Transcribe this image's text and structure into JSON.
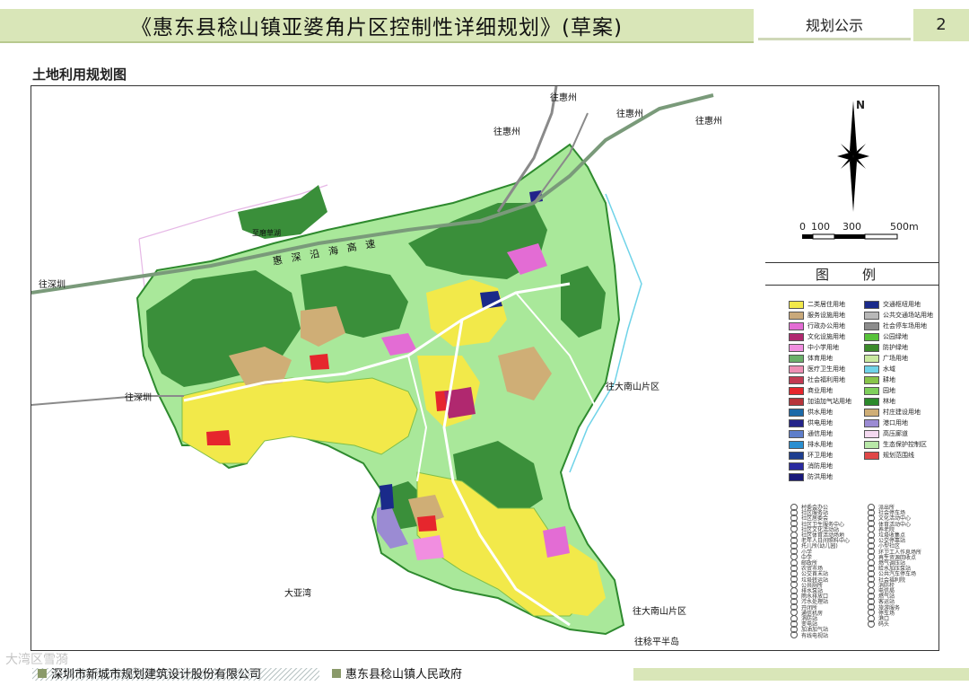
{
  "header": {
    "title": "《惠东县稔山镇亚婆角片区控制性详细规划》(草案)",
    "subtitle": "规划公示",
    "page_number": "2"
  },
  "section_title": "土地利用规划图",
  "map_labels": {
    "to_huizhou_1": "往惠州",
    "to_huizhou_2": "往惠州",
    "to_huizhou_3": "往惠州",
    "to_huizhou_4": "往惠州",
    "to_shenzhen_1": "往深圳",
    "to_shenzhen_2": "往深圳",
    "to_danan_1": "往大南山片区",
    "to_danan_2": "往大南山片区",
    "to_jianping": "往稔平半岛",
    "dayawan": "大亚湾",
    "zhimotouwan": "至磨草湖",
    "coastal_highway": "惠深沿海高速"
  },
  "compass": {
    "north": "N",
    "scale_ticks": [
      "0",
      "100",
      "300",
      "500m"
    ]
  },
  "legend": {
    "title_chars": [
      "图",
      "例"
    ],
    "left_items": [
      {
        "label": "二类居住用地",
        "color": "#f2e94a"
      },
      {
        "label": "服务设施用地",
        "color": "#c9a97a"
      },
      {
        "label": "行政办公用地",
        "color": "#e36cd4"
      },
      {
        "label": "文化设施用地",
        "color": "#b0286f"
      },
      {
        "label": "中小学用地",
        "color": "#f18ee0"
      },
      {
        "label": "体育用地",
        "color": "#6bb06a"
      },
      {
        "label": "医疗卫生用地",
        "color": "#ee8fb5"
      },
      {
        "label": "社会福利用地",
        "color": "#c33a53"
      },
      {
        "label": "商业用地",
        "color": "#e6262d"
      },
      {
        "label": "加油加气站用地",
        "color": "#b7343a"
      },
      {
        "label": "供水用地",
        "color": "#1c6aa8"
      },
      {
        "label": "供电用地",
        "color": "#23238a"
      },
      {
        "label": "通信用地",
        "color": "#5e7ecb"
      },
      {
        "label": "排水用地",
        "color": "#2a8fd0"
      },
      {
        "label": "环卫用地",
        "color": "#1e3e8f"
      },
      {
        "label": "消防用地",
        "color": "#2b2ba0"
      },
      {
        "label": "防洪用地",
        "color": "#18187a"
      }
    ],
    "right_items": [
      {
        "label": "交通枢纽用地",
        "color": "#1a2a8a"
      },
      {
        "label": "公共交通场站用地",
        "color": "#b8b8b8"
      },
      {
        "label": "社会停车场用地",
        "color": "#8c8c8c"
      },
      {
        "label": "公园绿地",
        "color": "#57c23a"
      },
      {
        "label": "防护绿地",
        "color": "#3b8a2a"
      },
      {
        "label": "广场用地",
        "color": "#c9e9a0"
      },
      {
        "label": "水域",
        "color": "#6fd3e8"
      },
      {
        "label": "耕地",
        "color": "#88c44a"
      },
      {
        "label": "园地",
        "color": "#7fcf5c"
      },
      {
        "label": "林地",
        "color": "#2c8a2c"
      },
      {
        "label": "村庄建设用地",
        "color": "#cfae76"
      },
      {
        "label": "港口用地",
        "color": "#9b8bd3"
      },
      {
        "label": "高压廊道",
        "color": "#f4d9f0"
      },
      {
        "label": "生态保护控制区",
        "color": "#b8e8a8"
      },
      {
        "label": "规划范围线",
        "color": "#e04848"
      }
    ],
    "icons_left": [
      "村委会办公",
      "社区服务站",
      "社区居委会",
      "社区卫生服务中心",
      "社区文化活动站",
      "社区体育活动场地",
      "老年人日间照料中心",
      "托儿所(幼儿园)",
      "小学",
      "中学",
      "邮政所",
      "农贸市场",
      "公交首末站",
      "垃圾转运站",
      "公共厕所",
      "排水泵站",
      "雨水排放口",
      "污水处理站",
      "开闭所",
      "通信机房",
      "消防站",
      "变电站",
      "加油加气站",
      "有线电视站"
    ],
    "icons_right": [
      "派出所",
      "社会停车场",
      "文化活动中心",
      "体育活动中心",
      "养老院",
      "垃圾收集点",
      "公交停靠站",
      "小型社区",
      "环卫工人作息场所",
      "再生资源回收点",
      "燃气调压站",
      "给水加压泵站",
      "公共汽车停车场",
      "社会福利院",
      "消防栓",
      "电信局",
      "燃气站",
      "客运站",
      "旅游服务",
      "停车场",
      "港口",
      "码头"
    ]
  },
  "footer": {
    "left": "深圳市新城市规划建筑设计股份有限公司",
    "right": "惠东县稔山镇人民政府"
  },
  "watermark": "大湾区雪漪"
}
